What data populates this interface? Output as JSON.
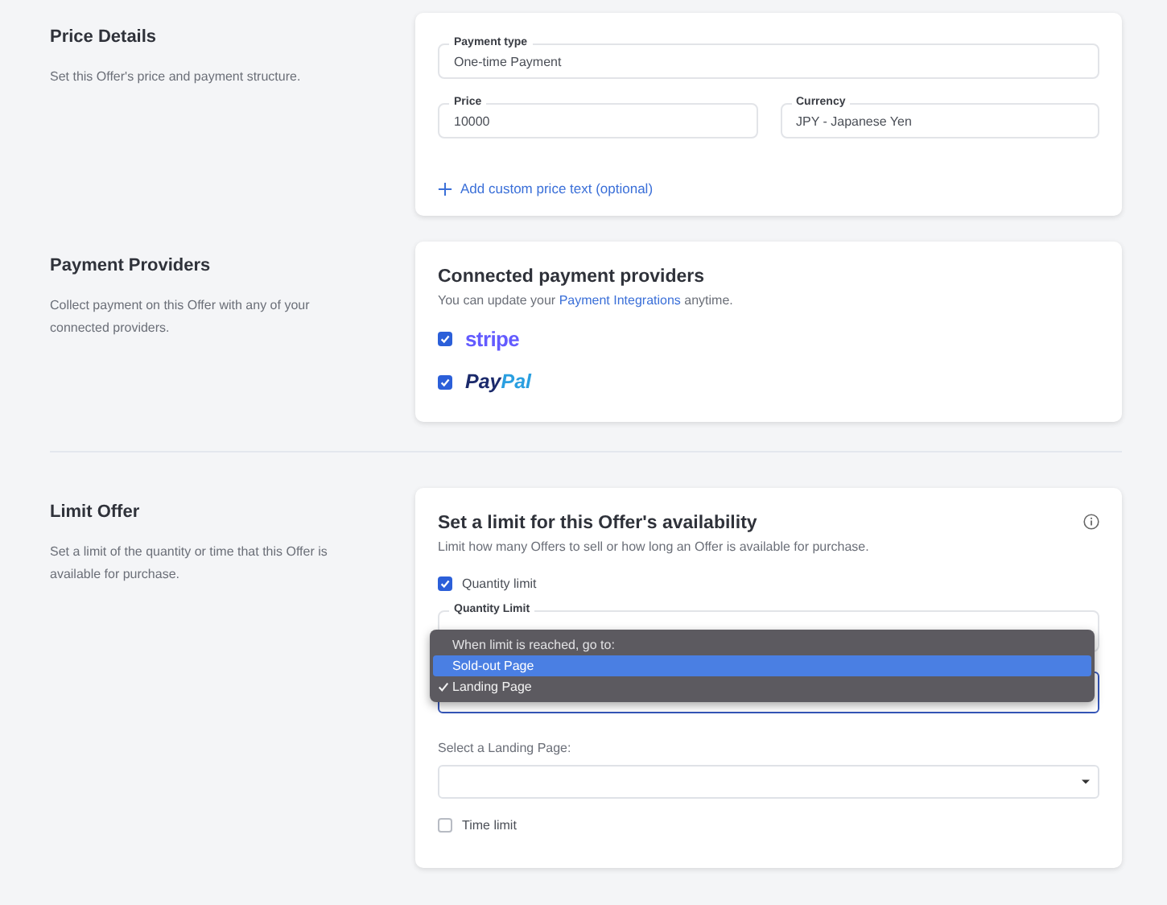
{
  "price_details": {
    "title": "Price Details",
    "description": "Set this Offer's price and payment structure.",
    "payment_type": {
      "label": "Payment type",
      "value": "One-time Payment"
    },
    "price": {
      "label": "Price",
      "value": "10000"
    },
    "currency": {
      "label": "Currency",
      "value": "JPY - Japanese Yen"
    },
    "add_link": "Add custom price text (optional)"
  },
  "payment_providers": {
    "title": "Payment Providers",
    "description": "Collect payment on this Offer with any of your connected providers.",
    "card_title": "Connected payment providers",
    "card_text_before": "You can update your ",
    "card_link": "Payment Integrations",
    "card_text_after": " anytime.",
    "providers": [
      {
        "kind": "stripe",
        "parts": [
          "stripe"
        ],
        "checked": true
      },
      {
        "kind": "paypal",
        "parts": [
          "Pay",
          "Pal"
        ],
        "checked": true
      }
    ]
  },
  "limit_offer": {
    "title": "Limit Offer",
    "description": "Set a limit of the quantity or time that this Offer is available for purchase.",
    "card_title": "Set a limit for this Offer's availability",
    "card_text": "Limit how many Offers to sell or how long an Offer is available for purchase.",
    "quantity_limit": {
      "label": "Quantity limit",
      "checked": true
    },
    "quantity_field": {
      "label": "Quantity Limit"
    },
    "menu": [
      {
        "label": "When limit is reached, go to:",
        "disabled": true,
        "selected": false,
        "checked": false
      },
      {
        "label": "Sold-out Page",
        "disabled": false,
        "selected": true,
        "checked": false
      },
      {
        "label": "Landing Page",
        "disabled": false,
        "selected": false,
        "checked": true
      }
    ],
    "landing_select": {
      "label": "Select a Landing Page:"
    },
    "time_limit": {
      "label": "Time limit",
      "checked": false
    }
  }
}
